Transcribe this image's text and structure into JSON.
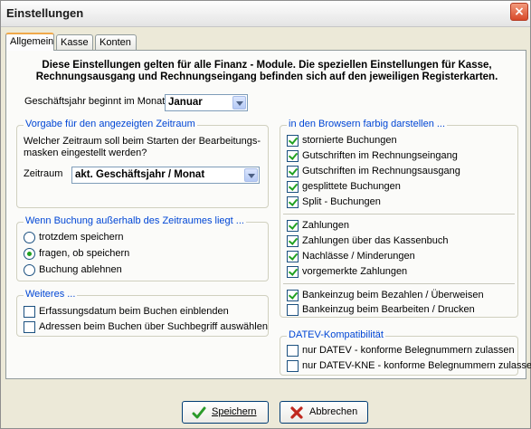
{
  "window": {
    "title": "Einstellungen",
    "close_label": "×"
  },
  "tabs": [
    "Allgemein",
    "Kasse",
    "Konten"
  ],
  "intro": {
    "line1": "Diese Einstellungen gelten für alle Finanz - Module. Die speziellen Einstellungen für Kasse,",
    "line2": "Rechnungsausgang und Rechnungseingang befinden sich auf den jeweiligen Registerkarten."
  },
  "fiscal_year": {
    "label": "Geschäftsjahr beginnt im Monat",
    "value": "Januar"
  },
  "period_group": {
    "title": "Vorgabe für den angezeigten Zeitraum",
    "question_line1": "Welcher Zeitraum soll beim Starten der Bearbeitungs-",
    "question_line2": "masken eingestellt werden?",
    "combo_label": "Zeitraum",
    "combo_value": "akt. Geschäftsjahr / Monat"
  },
  "outside_group": {
    "title": "Wenn Buchung außerhalb des Zeitraumes liegt ...",
    "options": [
      {
        "label": "trotzdem speichern",
        "selected": false
      },
      {
        "label": "fragen, ob speichern",
        "selected": true
      },
      {
        "label": "Buchung ablehnen",
        "selected": false
      }
    ]
  },
  "more_group": {
    "title": "Weiteres ...",
    "options": [
      {
        "label": "Erfassungsdatum beim Buchen einblenden",
        "checked": false
      },
      {
        "label": "Adressen beim Buchen über Suchbegriff auswählen",
        "checked": false
      }
    ]
  },
  "browser_group": {
    "title": "in den Browsern farbig darstellen ...",
    "section1": [
      {
        "label": "stornierte Buchungen",
        "checked": true
      },
      {
        "label": "Gutschriften im Rechnungseingang",
        "checked": true
      },
      {
        "label": "Gutschriften im Rechnungsausgang",
        "checked": true
      },
      {
        "label": "gesplittete Buchungen",
        "checked": true
      },
      {
        "label": "Split - Buchungen",
        "checked": true
      }
    ],
    "section2": [
      {
        "label": "Zahlungen",
        "checked": true
      },
      {
        "label": "Zahlungen über das Kassenbuch",
        "checked": true
      },
      {
        "label": "Nachlässe / Minderungen",
        "checked": true
      },
      {
        "label": "vorgemerkte Zahlungen",
        "checked": true
      }
    ],
    "section3": [
      {
        "label": "Bankeinzug beim Bezahlen / Überweisen",
        "checked": true
      },
      {
        "label": "Bankeinzug beim Bearbeiten / Drucken",
        "checked": false
      }
    ]
  },
  "datev_group": {
    "title": "DATEV-Kompatibilität",
    "options": [
      {
        "label": "nur DATEV - konforme Belegnummern zulassen",
        "checked": false
      },
      {
        "label": "nur DATEV-KNE - konforme Belegnummern zulassen",
        "checked": false
      }
    ]
  },
  "buttons": {
    "save": {
      "label": "Speichern",
      "icon": "checkmark-icon"
    },
    "cancel": {
      "label": "Abbrechen",
      "icon": "x-icon"
    }
  },
  "colors": {
    "legend": "#0046d5",
    "check": "#21a121",
    "tab_highlight": "#f0a94a"
  }
}
